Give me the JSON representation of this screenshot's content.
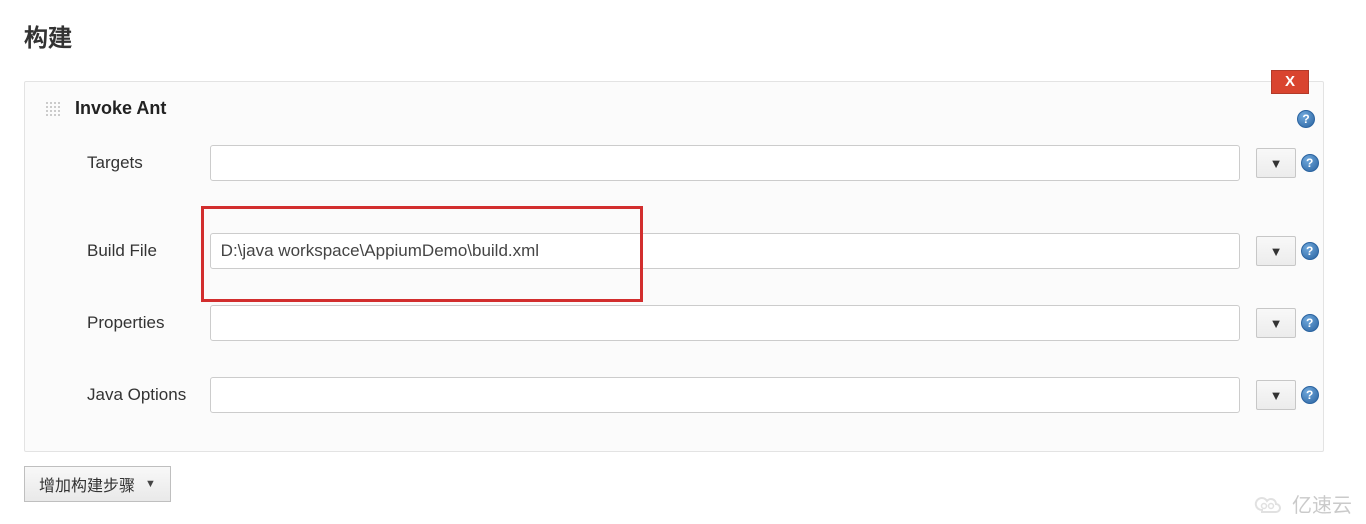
{
  "page": {
    "title": "构建"
  },
  "step": {
    "title": "Invoke Ant",
    "delete_label": "X",
    "fields": {
      "targets": {
        "label": "Targets",
        "value": ""
      },
      "build_file": {
        "label": "Build File",
        "value": "D:\\java workspace\\AppiumDemo\\build.xml"
      },
      "properties": {
        "label": "Properties",
        "value": ""
      },
      "java_options": {
        "label": "Java Options",
        "value": ""
      }
    },
    "expand_glyph": "▼",
    "help_glyph": "?"
  },
  "footer": {
    "add_step_label": "增加构建步骤",
    "caret": "▼"
  },
  "watermark": {
    "text": "亿速云"
  }
}
